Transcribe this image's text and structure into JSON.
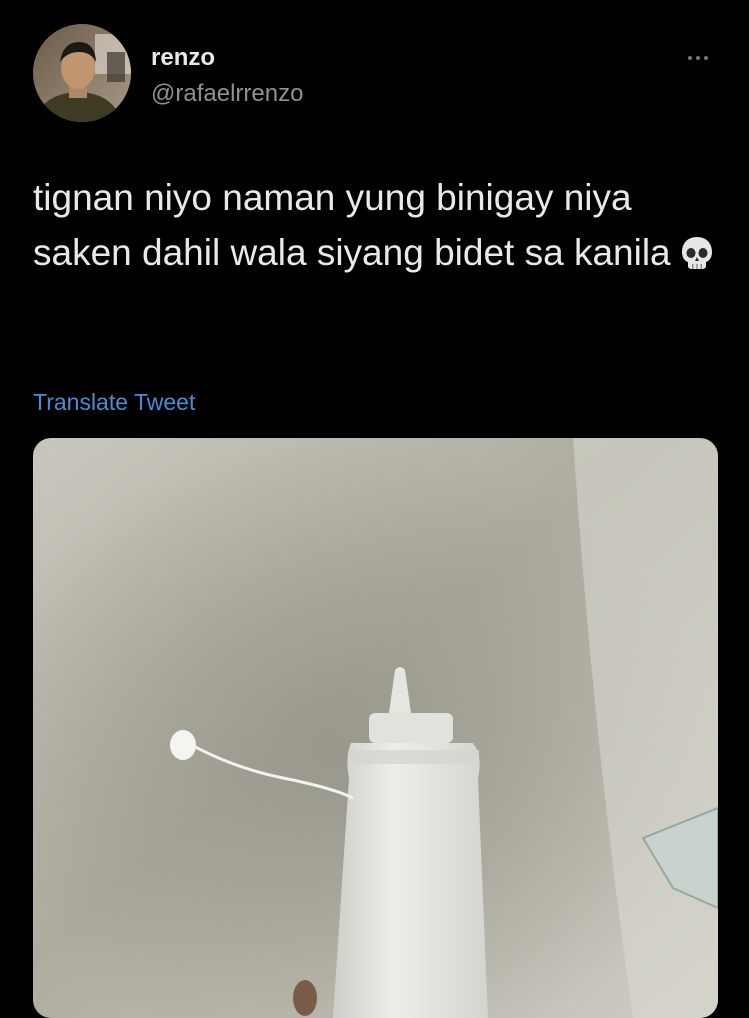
{
  "tweet": {
    "author": {
      "display_name": "renzo",
      "handle": "@rafaelrrenzo"
    },
    "text": "tignan niyo naman yung binigay niya saken dahil wala siyang bidet sa kanila",
    "emoji": "💀",
    "translate_label": "Translate Tweet"
  },
  "colors": {
    "background": "#000000",
    "primary_text": "#e7e9ea",
    "secondary_text": "#8b9298",
    "link": "#4a8dd6"
  }
}
